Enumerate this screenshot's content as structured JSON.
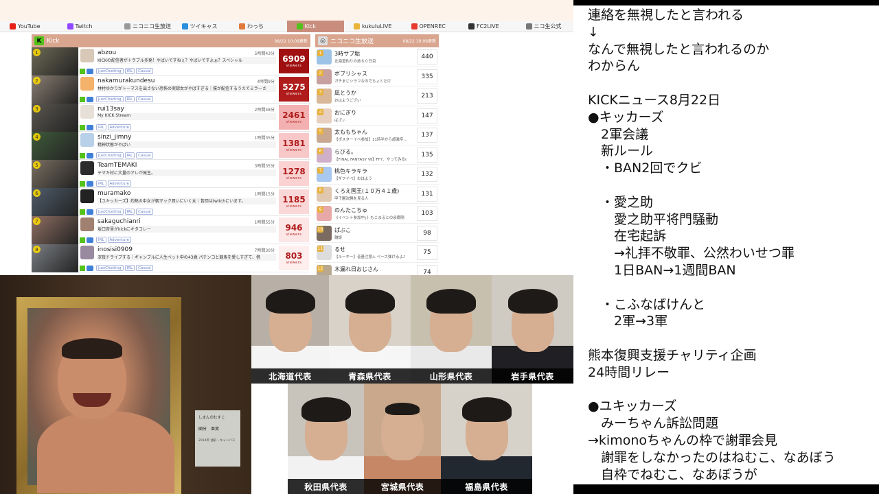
{
  "site": {
    "tabs": [
      {
        "label": "YouTube",
        "color": "#e62117",
        "active": false
      },
      {
        "label": "Twitch",
        "color": "#9146ff",
        "active": false
      },
      {
        "label": "ニコニコ生放送",
        "color": "#999999",
        "active": false
      },
      {
        "label": "ツイキャス",
        "color": "#2a8fdd",
        "active": false
      },
      {
        "label": "わっち",
        "color": "#e07a3a",
        "active": false
      },
      {
        "label": "Kick",
        "color": "#53c21a",
        "active": true
      },
      {
        "label": "kukuluLIVE",
        "color": "#e8b43a",
        "active": false
      },
      {
        "label": "OPENREC",
        "color": "#e63b2e",
        "active": false
      },
      {
        "label": "FC2LIVE",
        "color": "#333333",
        "active": false
      },
      {
        "label": "ニコ生公式",
        "color": "#777777",
        "active": false
      }
    ],
    "kick": {
      "header": "Kick",
      "date": "08/22 10:09更新",
      "rows": [
        {
          "rank": "1",
          "name": "abzou",
          "dur": "5時間43分",
          "title": "KICKの配信者がトラブル多発！やばいですねぇ？やばいですよぉ？スペシャル",
          "tags": [
            "JustChatting",
            "IRL",
            "Casual"
          ],
          "viewers": "6909",
          "vlabel": "viewers",
          "bg": "#a01010",
          "fg": "#ffffff"
        },
        {
          "rank": "2",
          "name": "nakamurakundesu",
          "dur": "4時間9分",
          "title": "林村ゆかりがトーマスを出さない恐怖の実録女がやばすぎる｜僕が配信するうえでミラーさ",
          "tags": [
            "JustChatting",
            "IRL",
            "Casual"
          ],
          "viewers": "5275",
          "vlabel": "viewers",
          "bg": "#b01c1c",
          "fg": "#ffffff"
        },
        {
          "rank": "3",
          "name": "rui13say",
          "dur": "2時間48分",
          "title": "My KICK Stream",
          "tags": [
            "IRL",
            "Adventure"
          ],
          "viewers": "2461",
          "vlabel": "viewers",
          "bg": "#f3b0b0",
          "fg": "#b01c1c"
        },
        {
          "rank": "4",
          "name": "sinzi_jimny",
          "dur": "1時間35分",
          "title": "精神状態がやばい",
          "tags": [
            "JustChatting",
            "IRL",
            "Casual"
          ],
          "viewers": "1381",
          "vlabel": "viewers",
          "bg": "#f8c8c8",
          "fg": "#b01c1c"
        },
        {
          "rank": "5",
          "name": "TeamTEMAKI",
          "dur": "3時間35分",
          "title": "テマキ村に大量のアレが発生。",
          "tags": [
            "IRL",
            "Adventure"
          ],
          "viewers": "1278",
          "vlabel": "viewers",
          "bg": "#fad2d2",
          "fg": "#b01c1c"
        },
        {
          "rank": "6",
          "name": "muramako",
          "dur": "1時間15分",
          "title": "【ユキッカーズ】灼熱の中女が朝マック買いにいく女｜昔回はtwitchにいます。",
          "tags": [
            "JustChatting",
            "IRL",
            "Casual"
          ],
          "viewers": "1185",
          "vlabel": "viewers",
          "bg": "#fbd8d8",
          "fg": "#b01c1c"
        },
        {
          "rank": "7",
          "name": "sakaguchianri",
          "dur": "1時間55分",
          "title": "坂口杏里がkickにキタコレー",
          "tags": [
            "IRL",
            "Adventure"
          ],
          "viewers": "946",
          "vlabel": "viewers",
          "bg": "#fde6e6",
          "fg": "#b01c1c"
        },
        {
          "rank": "8",
          "name": "inosisi0909",
          "dur": "7時間30分",
          "title": "深夜ドライブする｜ギャンブルに人生ベット中の43歳 パチンコと競馬を愛しすぎて、借",
          "tags": [
            "JustChatting",
            "IRL",
            "Casual"
          ],
          "viewers": "803",
          "vlabel": "viewers",
          "bg": "#feeeee",
          "fg": "#b01c1c"
        }
      ]
    },
    "nico": {
      "header": "ニコニコ生放送",
      "date": "08/22 10:09更新",
      "rows": [
        {
          "rank": "1",
          "name": "3時サブ垢",
          "sub": "北海道釣りの旅６０日目",
          "count": "440"
        },
        {
          "rank": "2",
          "name": "ボブリシャス",
          "sub": "ガチまじシラフなのでちょとだけ",
          "count": "335"
        },
        {
          "rank": "3",
          "name": "凪とうか",
          "sub": "おはようござい",
          "count": "213"
        },
        {
          "rank": "4",
          "name": "おにぎり",
          "sub": "ばざぃ",
          "count": "147"
        },
        {
          "rank": "5",
          "name": "太ももちゃん",
          "sub": "【ポスターイベ参加】11時半から超激辛…",
          "count": "137"
        },
        {
          "rank": "6",
          "name": "らびる。",
          "sub": "【FINAL FANTASY Ⅶ】FF7、やってみる(",
          "count": "135"
        },
        {
          "rank": "7",
          "name": "桃色キラキラ",
          "sub": "【ギフイベ】おはよう",
          "count": "132"
        },
        {
          "rank": "8",
          "name": "くろえ国王(１０万４１歳)",
          "sub": "甲子園決勝を見る人",
          "count": "131"
        },
        {
          "rank": "9",
          "name": "のんたこちゅ",
          "sub": "《イベント参加中」》もこまるとの余暇剛",
          "count": "103"
        },
        {
          "rank": "10",
          "name": "ぱぶこ",
          "sub": "雑談",
          "count": "98"
        },
        {
          "rank": "11",
          "name": "るせ",
          "sub": "【ルーキー】音量注意⚠ ベース弾けるよ♪",
          "count": "75"
        },
        {
          "rank": "12",
          "name": "木漏れ日おじさん",
          "sub": "",
          "count": "74"
        }
      ]
    }
  },
  "portrait": {
    "plaque_title": "しまんのむすこ",
    "plaque_name": "國分　亜実",
    "plaque_meta": "2014年 油彩・キャンバス"
  },
  "reps": [
    {
      "label": "北海道代表"
    },
    {
      "label": "青森県代表"
    },
    {
      "label": "山形県代表"
    },
    {
      "label": "岩手県代表"
    },
    {
      "label": "秋田県代表"
    },
    {
      "label": "宮城県代表"
    },
    {
      "label": "福島県代表"
    }
  ],
  "notes": {
    "lines": [
      "連絡を無視したと言われる",
      "↓",
      "なんで無視したと言われるのか",
      "わからん",
      "",
      "KICKニュース8月22日",
      "●キッカーズ",
      "　2軍会議",
      "　新ルール",
      "　・BAN2回でクビ",
      "",
      "　・愛之助",
      "　　愛之助平将門騒動",
      "　　在宅起訴",
      "　　→礼拝不敬罪、公然わいせつ罪",
      "　　1日BAN→1週間BAN",
      "",
      "　・こふなばけんと",
      "　　2軍→3軍",
      "",
      "熊本復興支援チャリティ企画",
      "24時間リレー",
      "",
      "●ユキッカーズ",
      "　みーちゃん訴訟問題",
      "→kimonoちゃんの枠で謝罪会見",
      "　謝罪をしなかったのはねむこ、なあぼう",
      "　自枠でねむこ、なあぼうが"
    ]
  }
}
